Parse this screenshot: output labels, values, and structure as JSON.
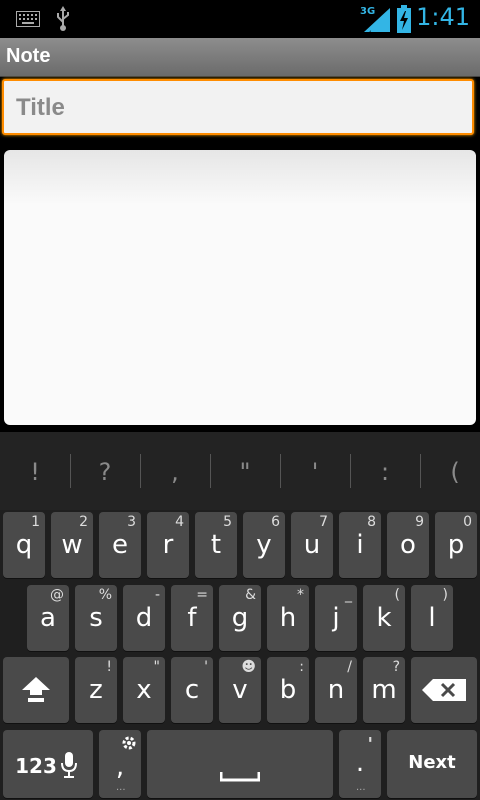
{
  "status": {
    "time": "1:41",
    "network": "3G",
    "accent_color": "#33b5e5",
    "left_icons": [
      "keyboard-icon",
      "usb-icon"
    ],
    "right_icons": [
      "signal-icon",
      "battery-charging-icon"
    ]
  },
  "title_bar": {
    "title": "Note"
  },
  "editor": {
    "title_placeholder": "Title",
    "focus_color": "#ff8c00"
  },
  "keyboard": {
    "suggestions": [
      "!",
      "?",
      ",",
      "\"",
      "'",
      ":",
      "("
    ],
    "row1": [
      {
        "key": "q",
        "hint": "1"
      },
      {
        "key": "w",
        "hint": "2"
      },
      {
        "key": "e",
        "hint": "3"
      },
      {
        "key": "r",
        "hint": "4"
      },
      {
        "key": "t",
        "hint": "5"
      },
      {
        "key": "y",
        "hint": "6"
      },
      {
        "key": "u",
        "hint": "7"
      },
      {
        "key": "i",
        "hint": "8"
      },
      {
        "key": "o",
        "hint": "9"
      },
      {
        "key": "p",
        "hint": "0"
      }
    ],
    "row2": [
      {
        "key": "a",
        "hint": "@"
      },
      {
        "key": "s",
        "hint": "%"
      },
      {
        "key": "d",
        "hint": "-"
      },
      {
        "key": "f",
        "hint": "="
      },
      {
        "key": "g",
        "hint": "&"
      },
      {
        "key": "h",
        "hint": "*"
      },
      {
        "key": "j",
        "hint": "_"
      },
      {
        "key": "k",
        "hint": "("
      },
      {
        "key": "l",
        "hint": ")"
      }
    ],
    "row3": [
      {
        "key": "z",
        "hint": "!"
      },
      {
        "key": "x",
        "hint": "\""
      },
      {
        "key": "c",
        "hint": "'"
      },
      {
        "key": "v",
        "hint": "☻"
      },
      {
        "key": "b",
        "hint": ":"
      },
      {
        "key": "n",
        "hint": "/"
      },
      {
        "key": "m",
        "hint": "?"
      }
    ],
    "symbols_label": "123",
    "comma": ",",
    "period": ".",
    "comma_hint": "'",
    "next_label": "Next"
  }
}
